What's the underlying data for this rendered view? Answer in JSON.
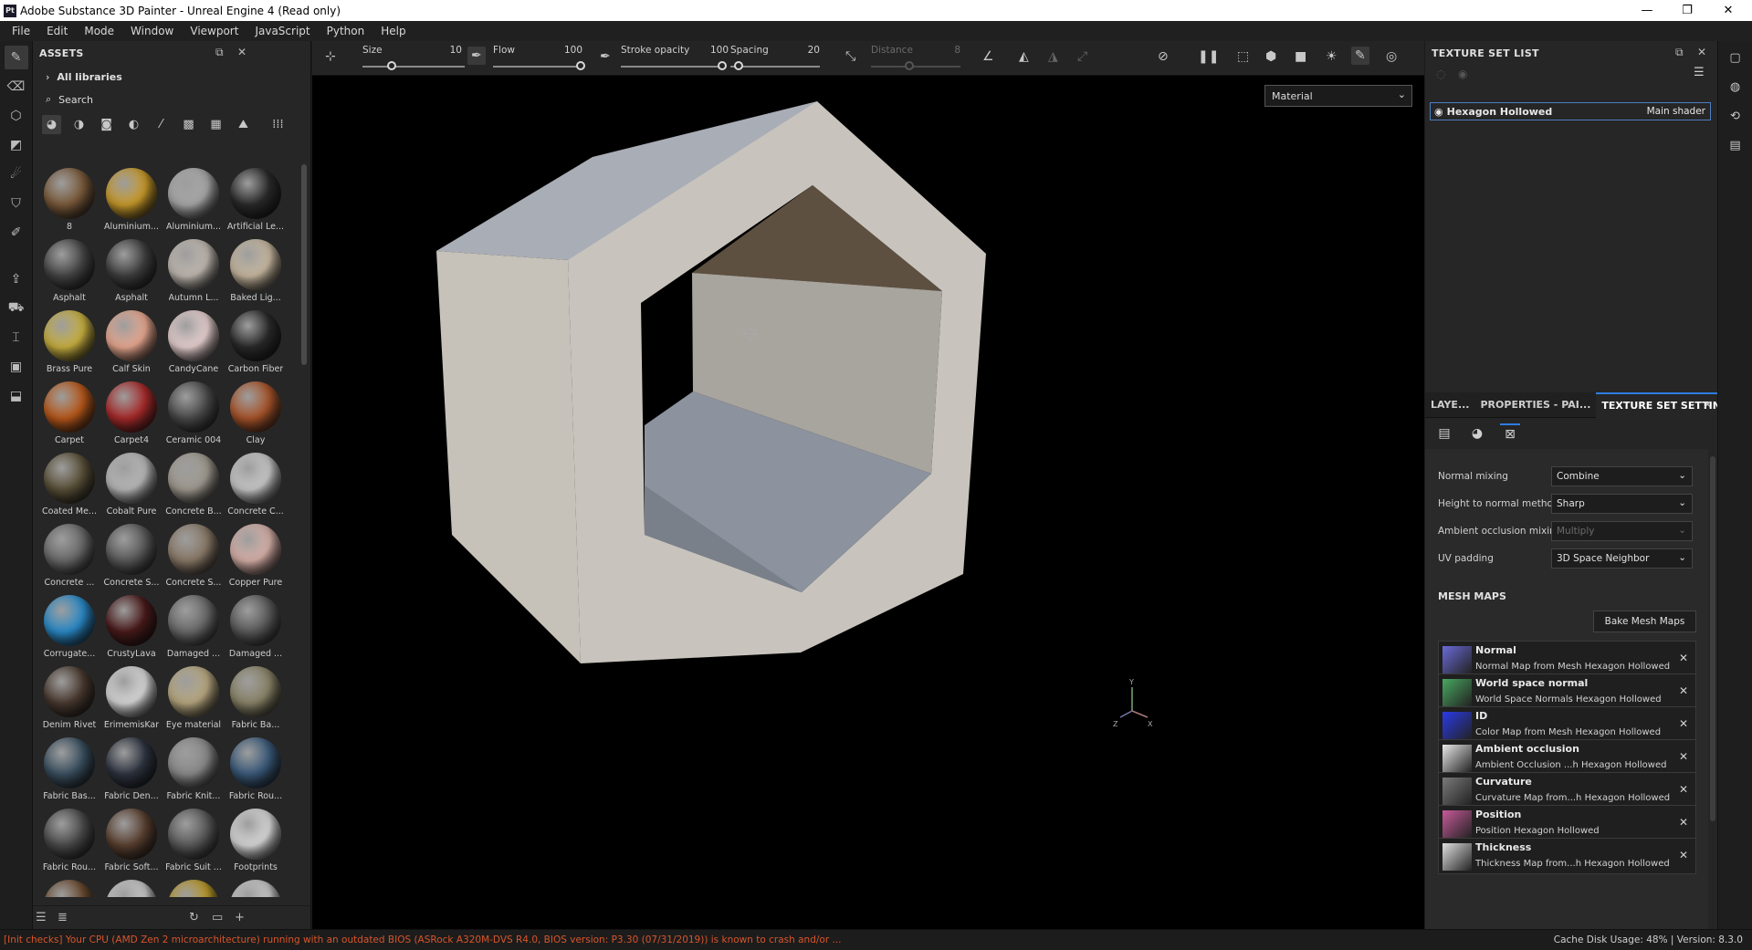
{
  "window": {
    "title": "Adobe Substance 3D Painter - Unreal Engine 4 (Read only)",
    "app_icon": "Pt",
    "controls": [
      "—",
      "❐",
      "✕"
    ]
  },
  "menu": [
    "File",
    "Edit",
    "Mode",
    "Window",
    "Viewport",
    "JavaScript",
    "Python",
    "Help"
  ],
  "assets": {
    "title": "ASSETS",
    "library": "All libraries",
    "search_placeholder": "Search",
    "items": [
      {
        "label": "8",
        "color": "#7a5a3a"
      },
      {
        "label": "Aluminium...",
        "color": "#c89a2a"
      },
      {
        "label": "Aluminium...",
        "color": "#a8a8a8"
      },
      {
        "label": "Artificial Le...",
        "color": "#2a2a2a"
      },
      {
        "label": "Asphalt",
        "color": "#454545"
      },
      {
        "label": "Asphalt",
        "color": "#3e3e3e"
      },
      {
        "label": "Autumn L...",
        "color": "#c0b8b0"
      },
      {
        "label": "Baked Lig...",
        "color": "#c8b8a0"
      },
      {
        "label": "Brass Pure",
        "color": "#c8b040"
      },
      {
        "label": "Calf Skin",
        "color": "#e8a890"
      },
      {
        "label": "CandyCane",
        "color": "#e8d0d0"
      },
      {
        "label": "Carbon Fiber",
        "color": "#2a2a2a"
      },
      {
        "label": "Carpet",
        "color": "#b8581a"
      },
      {
        "label": "Carpet4",
        "color": "#a82a2a"
      },
      {
        "label": "Ceramic 004",
        "color": "#4a4a4a"
      },
      {
        "label": "Clay",
        "color": "#a8542a"
      },
      {
        "label": "Coated Me...",
        "color": "#5a5038"
      },
      {
        "label": "Cobalt Pure",
        "color": "#b8b8b8"
      },
      {
        "label": "Concrete B...",
        "color": "#a09a90"
      },
      {
        "label": "Concrete C...",
        "color": "#c8c8c8"
      },
      {
        "label": "Concrete ...",
        "color": "#6a6a6a"
      },
      {
        "label": "Concrete S...",
        "color": "#5a5a5a"
      },
      {
        "label": "Concrete S...",
        "color": "#8a7a68"
      },
      {
        "label": "Copper Pure",
        "color": "#d8b0a8"
      },
      {
        "label": "Corrugate...",
        "color": "#2a8ac8"
      },
      {
        "label": "CrustyLava",
        "color": "#4a1a1a"
      },
      {
        "label": "Damaged ...",
        "color": "#6a6a6a"
      },
      {
        "label": "Damaged ...",
        "color": "#5a5a5a"
      },
      {
        "label": "Denim Rivet",
        "color": "#4a3a30"
      },
      {
        "label": "ErimemisKar",
        "color": "#d8d8d8"
      },
      {
        "label": "Eye material",
        "color": "#b8a880"
      },
      {
        "label": "Fabric Ba...",
        "color": "#8a8468"
      },
      {
        "label": "Fabric Bas...",
        "color": "#3a5060"
      },
      {
        "label": "Fabric Den...",
        "color": "#2e3440"
      },
      {
        "label": "Fabric Knit...",
        "color": "#8a8a8a"
      },
      {
        "label": "Fabric Rou...",
        "color": "#3a5a7a"
      },
      {
        "label": "Fabric Rou...",
        "color": "#4a4a4a"
      },
      {
        "label": "Fabric Soft...",
        "color": "#5a4030"
      },
      {
        "label": "Fabric Suit ...",
        "color": "#5a5a5a"
      },
      {
        "label": "Footprints",
        "color": "#d8d8d8"
      },
      {
        "label": "",
        "color": "#6a4a30"
      },
      {
        "label": "",
        "color": "#c8c8c8"
      },
      {
        "label": "",
        "color": "#b8982a"
      },
      {
        "label": "",
        "color": "#c8c8c8"
      }
    ]
  },
  "toolbar": {
    "size_label": "Size",
    "size_value": "10",
    "flow_label": "Flow",
    "flow_value": "100",
    "opacity_label": "Stroke opacity",
    "opacity_value": "100",
    "spacing_label": "Spacing",
    "spacing_value": "20",
    "distance_label": "Distance",
    "distance_value": "8"
  },
  "viewport": {
    "mode": "Material",
    "axis_labels": [
      "Y",
      "X",
      "Z"
    ]
  },
  "texture_set_list": {
    "title": "TEXTURE SET LIST",
    "item": "Hexagon Hollowed",
    "shader": "Main shader"
  },
  "tabs": [
    "LAYE...",
    "PROPERTIES - PAI...",
    "TEXTURE SET SETTIN..."
  ],
  "texture_set_settings": {
    "normal_mixing_label": "Normal mixing",
    "normal_mixing": "Combine",
    "height_method_label": "Height to normal method",
    "height_method": "Sharp",
    "ao_mixing_label": "Ambient occlusion mixing",
    "ao_mixing": "Multiply",
    "uv_padding_label": "UV padding",
    "uv_padding": "3D Space Neighbor",
    "mesh_maps_title": "MESH MAPS",
    "bake_button": "Bake Mesh Maps",
    "mesh_maps": [
      {
        "name": "Normal",
        "desc": "Normal Map from Mesh Hexagon Hollowed",
        "color": "#6a6ad8"
      },
      {
        "name": "World space normal",
        "desc": "World Space Normals Hexagon Hollowed",
        "color": "#48a860"
      },
      {
        "name": "ID",
        "desc": "Color Map from Mesh Hexagon Hollowed",
        "color": "#2a3ae8"
      },
      {
        "name": "Ambient occlusion",
        "desc": "Ambient Occlusion ...h Hexagon Hollowed",
        "color": "#e8e8e8"
      },
      {
        "name": "Curvature",
        "desc": "Curvature Map from...h Hexagon Hollowed",
        "color": "#7a7a7a"
      },
      {
        "name": "Position",
        "desc": "Position Hexagon Hollowed",
        "color": "#c85a9a"
      },
      {
        "name": "Thickness",
        "desc": "Thickness Map from...h Hexagon Hollowed",
        "color": "#e0e0e0"
      }
    ]
  },
  "status": {
    "warning": "[Init checks] Your CPU (AMD Zen 2 microarchitecture) running with an outdated BIOS (ASRock A320M-DVS R4.0, BIOS version: P3.30 (07/31/2019)) is known to crash and/or ...",
    "cache": "Cache Disk Usage:   48% | Version: 8.3.0"
  }
}
